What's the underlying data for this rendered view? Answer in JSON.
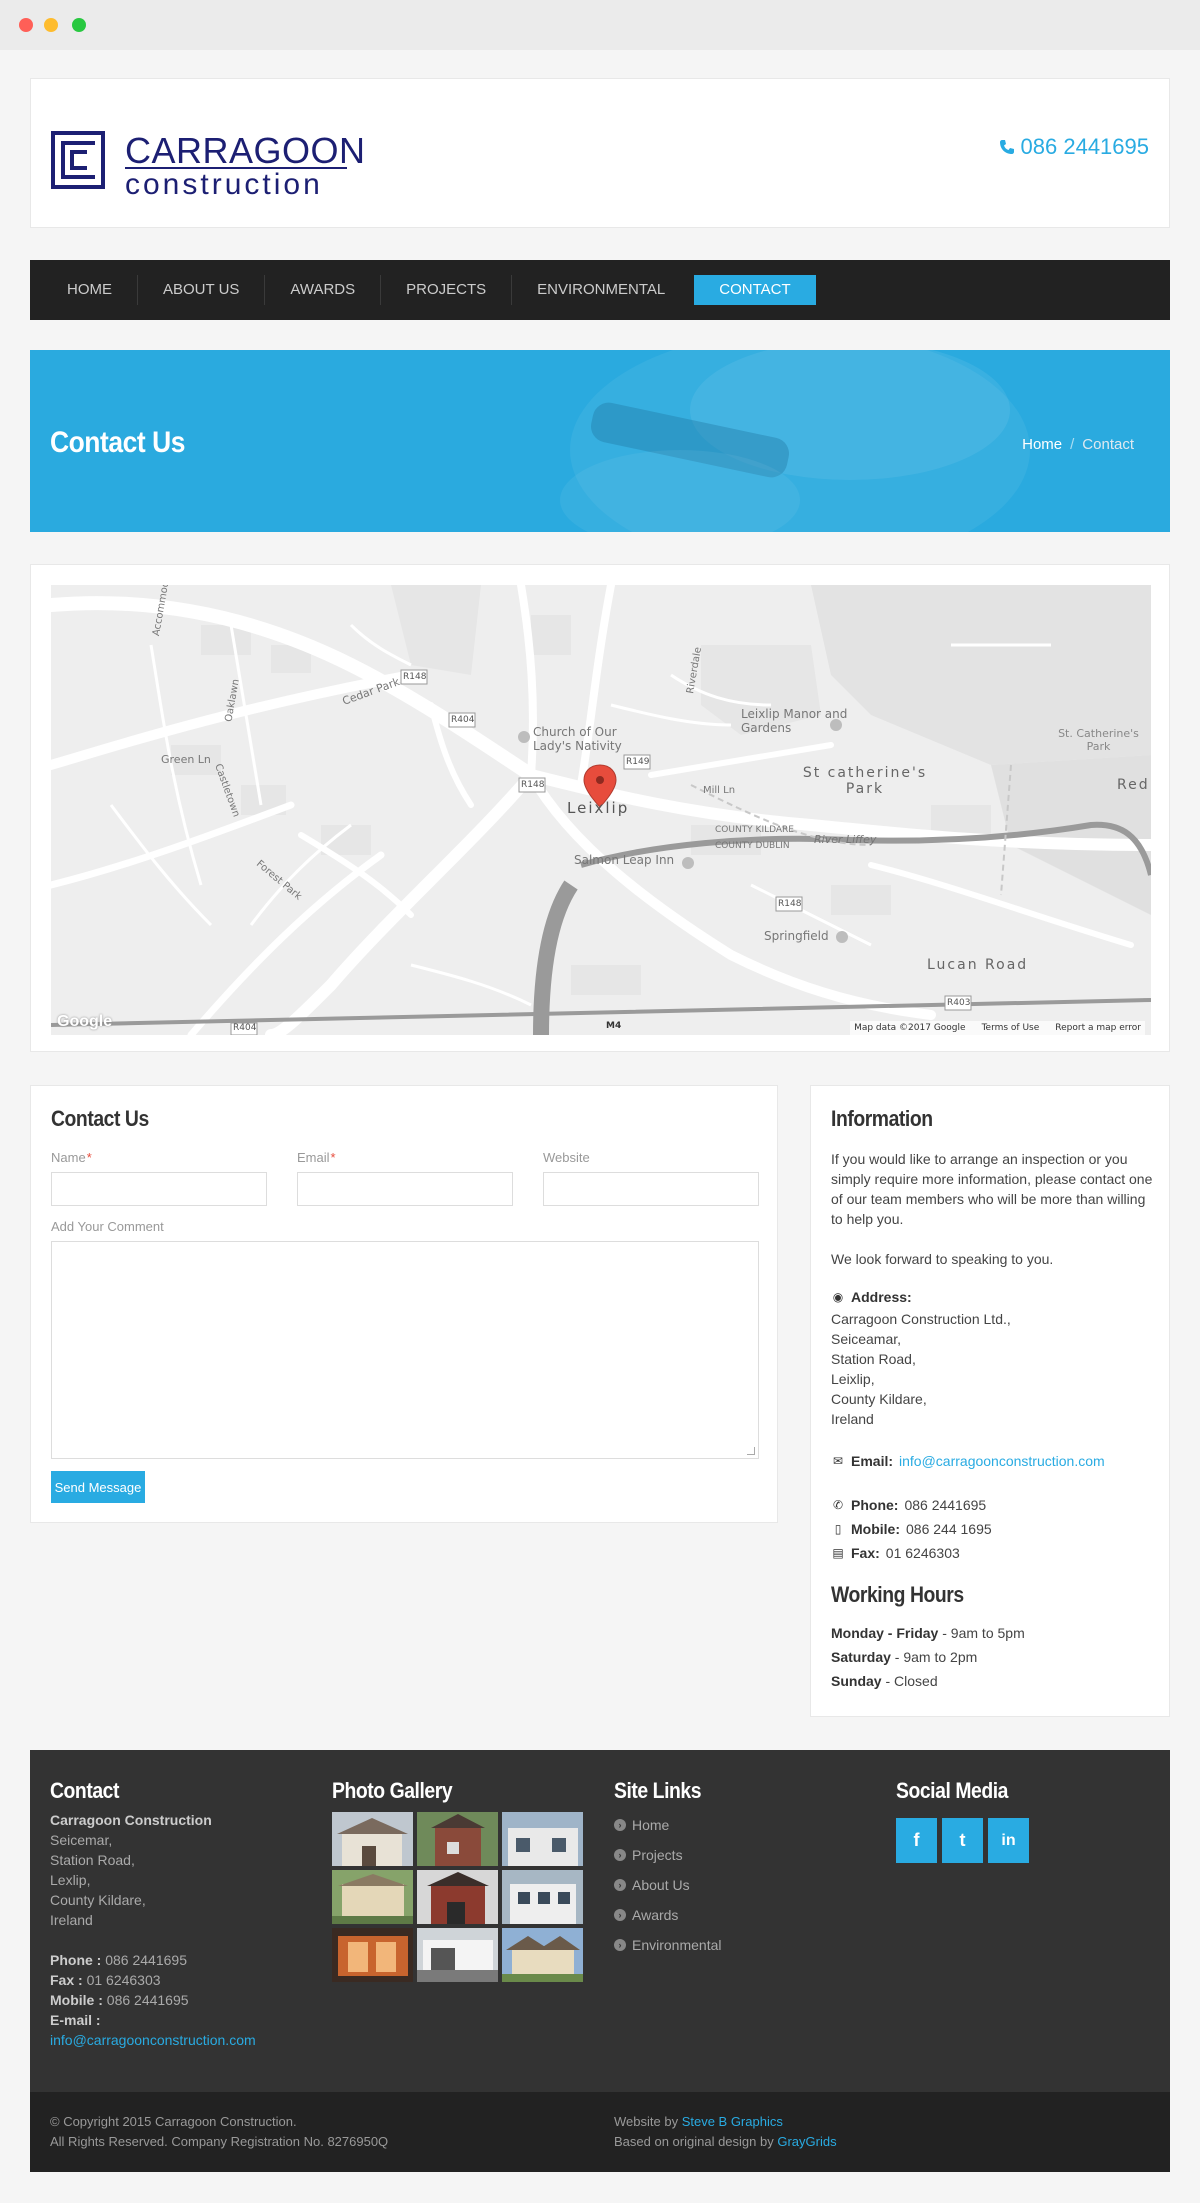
{
  "header": {
    "logo_top": "CARRAGOON",
    "logo_bottom": "construction",
    "phone": "086 2441695",
    "phone_icon": "phone-icon"
  },
  "nav": {
    "items": [
      {
        "label": "HOME"
      },
      {
        "label": "ABOUT US"
      },
      {
        "label": "AWARDS"
      },
      {
        "label": "PROJECTS"
      },
      {
        "label": "ENVIRONMENTAL"
      },
      {
        "label": "CONTACT",
        "active": true
      }
    ]
  },
  "banner": {
    "title": "Contact Us",
    "breadcrumb_home": "Home",
    "breadcrumb_sep": "/",
    "breadcrumb_current": "Contact"
  },
  "map": {
    "labels": {
      "leixlip": "Leixlip",
      "church": "Church of Our Lady's Nativity",
      "manor": "Leixlip Manor and Gardens",
      "st_catherines": "St catherine's Park",
      "st_catherines_small": "St. Catherine's Park",
      "red": "Red",
      "salmon": "Salmon Leap Inn",
      "springfield": "Springfield",
      "lucan": "Lucan Road",
      "river": "River Liffey",
      "kildare": "COUNTY KILDARE",
      "dublin": "COUNTY DUBLIN",
      "mill": "Mill Ln",
      "green": "Green Ln",
      "cedar": "Cedar Park",
      "accom": "Accommodation Rd",
      "forest": "Forest Park",
      "castletown": "Castletown",
      "oaklawn": "Oaklawn",
      "riverdale": "Riverdale",
      "r148": "R148",
      "r404": "R404",
      "r149": "R149",
      "r403": "R403",
      "m4": "M4"
    },
    "google": "Google",
    "map_data": "Map data ©2017 Google",
    "terms": "Terms of Use",
    "report": "Report a map error"
  },
  "form": {
    "title": "Contact Us",
    "name_label": "Name",
    "email_label": "Email",
    "website_label": "Website",
    "required_mark": "*",
    "comment_label": "Add Your Comment",
    "send_label": "Send Message"
  },
  "info": {
    "title": "Information",
    "intro": "If you would like to arrange an inspection or you simply require more information, please contact one of our team members who will be more than willing to help you.",
    "look_forward": "We look forward to speaking to you.",
    "address_label": "Address:",
    "address_lines": [
      "Carragoon Construction Ltd.,",
      "Seiceamar,",
      "Station Road,",
      "Leixlip,",
      "County Kildare,",
      "Ireland"
    ],
    "email_label": "Email:",
    "email": "info@carragoonconstruction.com",
    "phone_label": "Phone:",
    "phone": "086 2441695",
    "mobile_label": "Mobile:",
    "mobile": "086 244 1695",
    "fax_label": "Fax:",
    "fax": "01 6246303",
    "hours_title": "Working Hours",
    "hours": [
      {
        "day": "Monday - Friday",
        "time": " - 9am to 5pm"
      },
      {
        "day": "Saturday",
        "time": " - 9am to 2pm"
      },
      {
        "day": "Sunday",
        "time": " - Closed"
      }
    ]
  },
  "footer": {
    "contact_title": "Contact",
    "company": "Carragoon Construction",
    "address_lines": [
      "Seicemar,",
      "Station Road,",
      "Lexlip,",
      "County Kildare,",
      "Ireland"
    ],
    "phone_label": "Phone :",
    "phone": " 086 2441695",
    "fax_label": "Fax :",
    "fax": " 01 6246303",
    "mobile_label": "Mobile :",
    "mobile": " 086 2441695",
    "email_label": "E-mail :",
    "email": "info@carragoonconstruction.com",
    "gallery_title": "Photo Gallery",
    "links_title": "Site Links",
    "links": [
      "Home",
      "Projects",
      "About Us",
      "Awards",
      "Environmental"
    ],
    "social_title": "Social Media",
    "socials": [
      {
        "icon": "facebook-icon",
        "glyph": "f"
      },
      {
        "icon": "twitter-icon",
        "glyph": "t"
      },
      {
        "icon": "linkedin-icon",
        "glyph": "in"
      }
    ]
  },
  "bottom": {
    "copyright": "© Copyright 2015 Carragoon Construction.",
    "rights": "All Rights Reserved. Company Registration No. 8276950Q",
    "website_by": "Website by ",
    "website_by_link": "Steve B Graphics",
    "based_on": "Based on original design by ",
    "based_on_link": "GrayGrids"
  },
  "colors": {
    "accent": "#29abe2",
    "nav_bg": "#222222",
    "footer_bg": "#333333",
    "logo_navy": "#1c1f73"
  }
}
